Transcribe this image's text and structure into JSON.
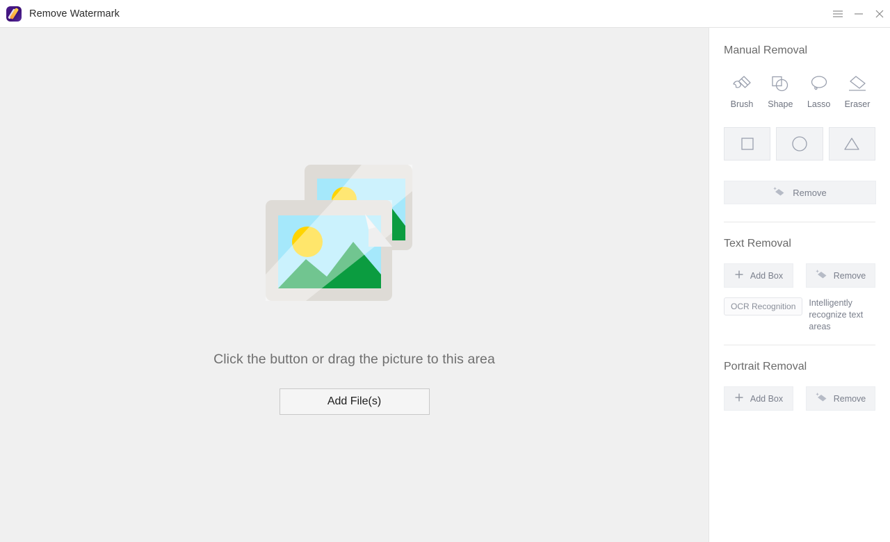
{
  "window": {
    "title": "Remove Watermark",
    "logo_icon": "app-logo-brush-icon",
    "controls": {
      "menu": "menu-icon",
      "minimize": "minimize-icon",
      "close": "close-icon"
    },
    "accent_color": "#3c1175"
  },
  "workspace": {
    "illustration": "two-photos-placeholder-icon",
    "drop_text": "Click the button or drag the picture to this area",
    "add_files_label": "Add File(s)",
    "background_color": "#f0f0f0",
    "illustration_colors": {
      "frame": "#dedbd6",
      "sky": "#a5e8fb",
      "sun": "#ffd400",
      "mountain": "#0b9c40",
      "shadow": "#c9c6c1"
    }
  },
  "panel": {
    "manual": {
      "title": "Manual Removal",
      "tools": [
        {
          "label": "Brush",
          "icon": "brush-icon"
        },
        {
          "label": "Shape",
          "icon": "shape-icon"
        },
        {
          "label": "Lasso",
          "icon": "lasso-icon"
        },
        {
          "label": "Eraser",
          "icon": "eraser-icon"
        }
      ],
      "shapes": [
        {
          "name": "rectangle",
          "icon": "square-icon"
        },
        {
          "name": "ellipse",
          "icon": "circle-icon"
        },
        {
          "name": "triangle",
          "icon": "triangle-icon"
        }
      ],
      "remove_label": "Remove",
      "remove_icon": "eraser-sparkle-icon"
    },
    "text": {
      "title": "Text Removal",
      "add_box_label": "Add Box",
      "add_box_icon": "plus-icon",
      "remove_label": "Remove",
      "remove_icon": "eraser-sparkle-icon",
      "ocr_label": "OCR Recognition",
      "ocr_hint": "Intelligently recognize text areas"
    },
    "portrait": {
      "title": "Portrait Removal",
      "add_box_label": "Add Box",
      "add_box_icon": "plus-icon",
      "remove_label": "Remove",
      "remove_icon": "eraser-sparkle-icon"
    }
  }
}
